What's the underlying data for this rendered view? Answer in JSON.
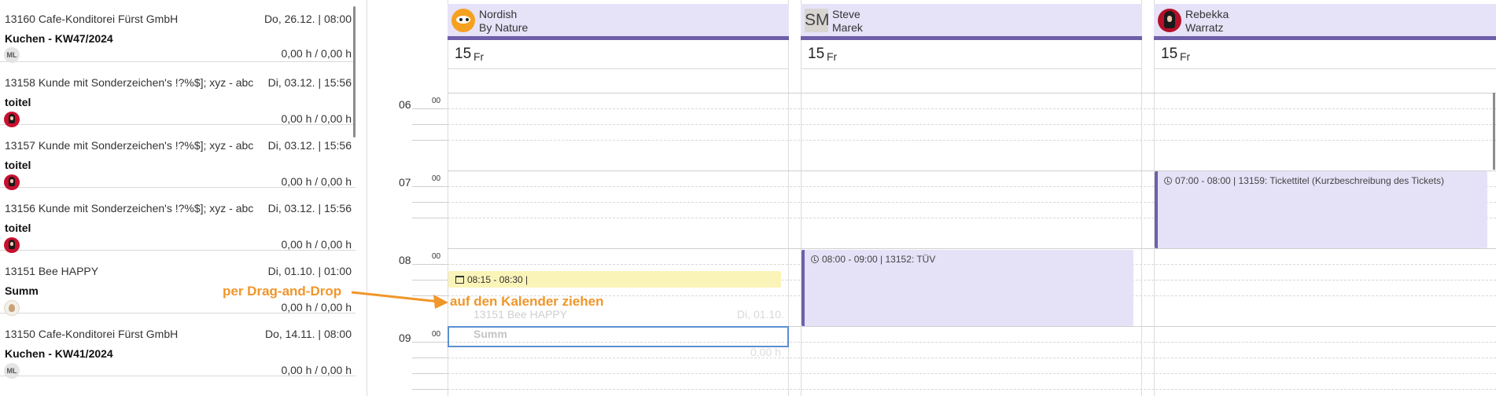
{
  "tickets": [
    {
      "title": "13160 Cafe-Konditorei Fürst GmbH",
      "date": "Do, 26.12. | 08:00",
      "subject": "Kuchen - KW47/2024",
      "assignee": "ML",
      "hours": "0,00 h / 0,00 h"
    },
    {
      "title": "13158 Kunde mit Sonderzeichen's !?%$]; xyz - abc",
      "date": "Di, 03.12. | 15:56",
      "subject": "toitel",
      "assignee": "",
      "hours": "0,00 h / 0,00 h"
    },
    {
      "title": "13157 Kunde mit Sonderzeichen's !?%$]; xyz - abc",
      "date": "Di, 03.12. | 15:56",
      "subject": "toitel",
      "assignee": "",
      "hours": "0,00 h / 0,00 h"
    },
    {
      "title": "13156 Kunde mit Sonderzeichen's !?%$]; xyz - abc",
      "date": "Di, 03.12. | 15:56",
      "subject": "toitel",
      "assignee": "",
      "hours": "0,00 h / 0,00 h"
    },
    {
      "title": "13151 Bee HAPPY",
      "date": "Di, 01.10. | 01:00",
      "subject": "Summ",
      "assignee": "",
      "hours": "0,00 h / 0,00 h"
    },
    {
      "title": "13150 Cafe-Konditorei Fürst GmbH",
      "date": "Do, 14.11. | 08:00",
      "subject": "Kuchen - KW41/2024",
      "assignee": "ML",
      "hours": "0,00 h / 0,00 h"
    }
  ],
  "calendar": {
    "columns": [
      {
        "name_line1": "Nordish",
        "name_line2": "By Nature",
        "avatar": "orange-mascot-avatar",
        "day_num": "15",
        "day_name": "Fr"
      },
      {
        "name_line1": "Steve",
        "name_line2": "Marek",
        "avatar_initials": "SM",
        "day_num": "15",
        "day_name": "Fr"
      },
      {
        "name_line1": "Rebekka",
        "name_line2": "Warratz",
        "avatar": "red-photo-avatar",
        "day_num": "15",
        "day_name": "Fr"
      }
    ],
    "hours": [
      "06",
      "07",
      "08",
      "09"
    ],
    "minutes_label": "00",
    "events": [
      {
        "text": "07:00 - 08:00 | 13159: Tickettitel (Kurzbeschreibung des Tickets)",
        "column": "Rebekka Warratz"
      },
      {
        "text": "08:00 - 09:00 | 13152: TÜV",
        "column": "Steve Marek"
      }
    ],
    "drag_preview": {
      "time": "08:15 - 08:30 |",
      "ghost_title": "13151 Bee HAPPY",
      "ghost_date": "Di, 01.10.",
      "ghost_subject": "Summ",
      "ghost_hours": "0,00 h"
    }
  },
  "annotations": {
    "drag_hint": "per Drag-and-Drop",
    "drop_hint": "auf den Kalender ziehen",
    "color": "#f0962a"
  },
  "colors": {
    "header_bg": "#e6e3f9",
    "accent": "#6f5faa",
    "event_bg": "#e5e2f8",
    "drag_bg": "#fbf4b8",
    "drop_border": "#5b8fd0"
  }
}
